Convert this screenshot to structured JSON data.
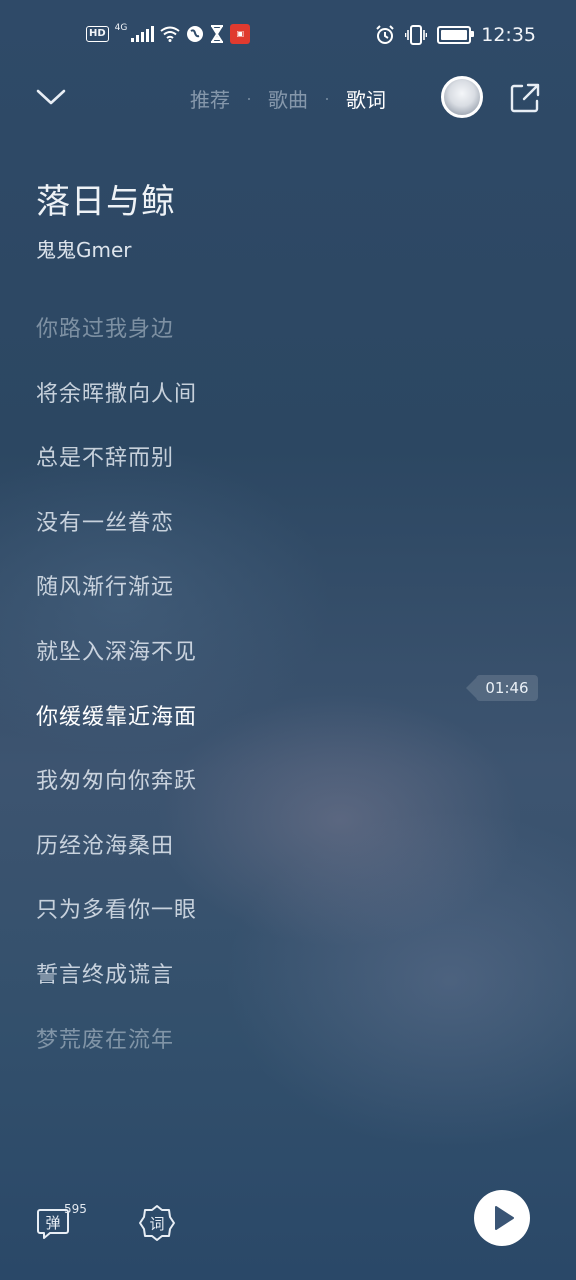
{
  "status_bar": {
    "hd": "HD",
    "network": "4G",
    "time": "12:35"
  },
  "header": {
    "tabs": [
      {
        "label": "推荐"
      },
      {
        "label": "歌曲"
      },
      {
        "label": "歌词"
      }
    ],
    "active_tab": "歌词"
  },
  "song": {
    "title": "落日与鲸",
    "artist": "鬼鬼Gmer"
  },
  "lyrics": [
    {
      "text": "你路过我身边"
    },
    {
      "text": "将余晖撒向人间"
    },
    {
      "text": "总是不辞而别"
    },
    {
      "text": "没有一丝眷恋"
    },
    {
      "text": "随风渐行渐远"
    },
    {
      "text": "就坠入深海不见"
    },
    {
      "text": "你缓缓靠近海面"
    },
    {
      "text": "我匆匆向你奔跃"
    },
    {
      "text": "历经沧海桑田"
    },
    {
      "text": "只为多看你一眼"
    },
    {
      "text": "誓言终成谎言"
    },
    {
      "text": "梦荒废在流年"
    }
  ],
  "current_line_index": 6,
  "time_marker": "01:46",
  "bottom": {
    "danmaku_label": "弹",
    "danmaku_count": "595",
    "lyric_mode_label": "词"
  },
  "colors": {
    "accent": "#ffffff",
    "background_top": "#2f4a68",
    "background_bottom": "#2a4868"
  }
}
